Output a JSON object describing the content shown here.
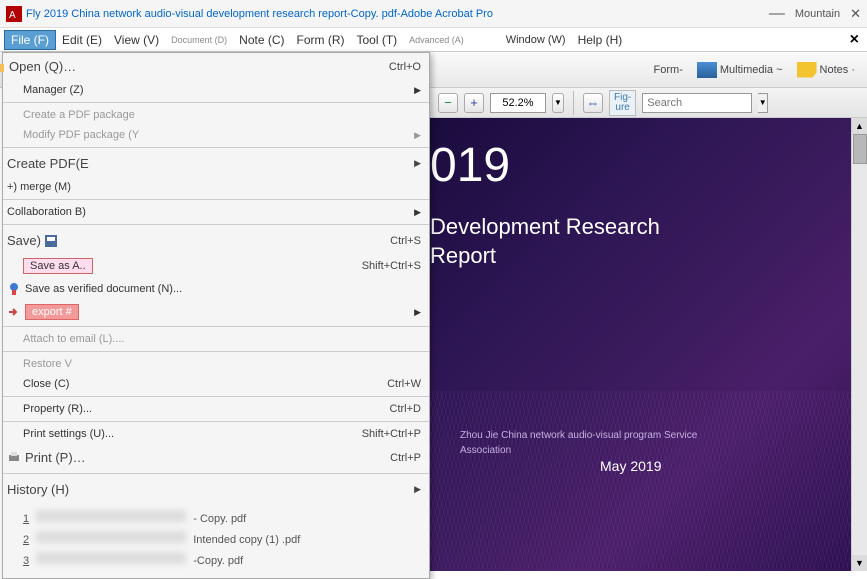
{
  "titlebar": {
    "title": "Fly 2019 China network audio-visual development research report-Copy. pdf-Adobe Acrobat Pro",
    "right_text": "Mountain"
  },
  "menubar": {
    "file": "File (F)",
    "edit": "Edit (E)",
    "view": "View (V)",
    "document": "Document (D)",
    "note": "Note (C)",
    "form": "Form (R)",
    "tool": "Tool (T)",
    "advanced": "Advanced (A)",
    "window": "Window (W)",
    "help": "Help (H)"
  },
  "toolbar": {
    "form": "Form-",
    "multimedia": "Multimedia ~",
    "notes": "Notes ·"
  },
  "subtool": {
    "zoom_value": "52.2%",
    "figure": "Fig-\nure",
    "search_placeholder": "Search"
  },
  "file_menu": {
    "open": "Open (Q)…",
    "open_sc": "Ctrl+O",
    "manager": "Manager (Z)",
    "create_pkg": "Create a PDF package",
    "modify_pkg": "Modify PDF package (Y",
    "create_pdf": "Create PDF(E",
    "merge": "+) merge (M)",
    "collab": "Collaboration B)",
    "save": "Save)",
    "save_sc": "Ctrl+S",
    "save_as": "Save as A..",
    "save_as_sc": "Shift+Ctrl+S",
    "save_verified": "Save as verified document (N)...",
    "export": "export #",
    "attach": "Attach to email (L)....",
    "restore": "Restore V",
    "close": "Close (C)",
    "close_sc": "Ctrl+W",
    "property": "Property (R)...",
    "property_sc": "Ctrl+D",
    "print_settings": "Print settings (U)...",
    "print_settings_sc": "Shift+Ctrl+P",
    "print": "Print (P)…",
    "print_sc": "Ctrl+P",
    "history": "History (H)",
    "h1_suffix": "- Copy. pdf",
    "h2_suffix": "Intended copy (1) .pdf",
    "h3_suffix": "-Copy. pdf"
  },
  "document": {
    "year": "019",
    "subtitle": "Development Research\nReport",
    "source": "Zhou Jie China network audio-visual program Service\nAssociation",
    "date": "May 2019"
  }
}
